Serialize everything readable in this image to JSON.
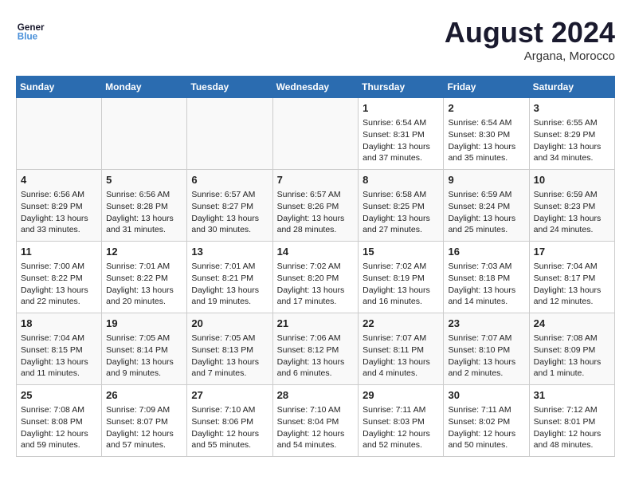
{
  "logo": {
    "line1": "General",
    "line2": "Blue"
  },
  "title": "August 2024",
  "location": "Argana, Morocco",
  "days_of_week": [
    "Sunday",
    "Monday",
    "Tuesday",
    "Wednesday",
    "Thursday",
    "Friday",
    "Saturday"
  ],
  "weeks": [
    [
      {
        "day": "",
        "content": ""
      },
      {
        "day": "",
        "content": ""
      },
      {
        "day": "",
        "content": ""
      },
      {
        "day": "",
        "content": ""
      },
      {
        "day": "1",
        "content": "Sunrise: 6:54 AM\nSunset: 8:31 PM\nDaylight: 13 hours and 37 minutes."
      },
      {
        "day": "2",
        "content": "Sunrise: 6:54 AM\nSunset: 8:30 PM\nDaylight: 13 hours and 35 minutes."
      },
      {
        "day": "3",
        "content": "Sunrise: 6:55 AM\nSunset: 8:29 PM\nDaylight: 13 hours and 34 minutes."
      }
    ],
    [
      {
        "day": "4",
        "content": "Sunrise: 6:56 AM\nSunset: 8:29 PM\nDaylight: 13 hours and 33 minutes."
      },
      {
        "day": "5",
        "content": "Sunrise: 6:56 AM\nSunset: 8:28 PM\nDaylight: 13 hours and 31 minutes."
      },
      {
        "day": "6",
        "content": "Sunrise: 6:57 AM\nSunset: 8:27 PM\nDaylight: 13 hours and 30 minutes."
      },
      {
        "day": "7",
        "content": "Sunrise: 6:57 AM\nSunset: 8:26 PM\nDaylight: 13 hours and 28 minutes."
      },
      {
        "day": "8",
        "content": "Sunrise: 6:58 AM\nSunset: 8:25 PM\nDaylight: 13 hours and 27 minutes."
      },
      {
        "day": "9",
        "content": "Sunrise: 6:59 AM\nSunset: 8:24 PM\nDaylight: 13 hours and 25 minutes."
      },
      {
        "day": "10",
        "content": "Sunrise: 6:59 AM\nSunset: 8:23 PM\nDaylight: 13 hours and 24 minutes."
      }
    ],
    [
      {
        "day": "11",
        "content": "Sunrise: 7:00 AM\nSunset: 8:22 PM\nDaylight: 13 hours and 22 minutes."
      },
      {
        "day": "12",
        "content": "Sunrise: 7:01 AM\nSunset: 8:22 PM\nDaylight: 13 hours and 20 minutes."
      },
      {
        "day": "13",
        "content": "Sunrise: 7:01 AM\nSunset: 8:21 PM\nDaylight: 13 hours and 19 minutes."
      },
      {
        "day": "14",
        "content": "Sunrise: 7:02 AM\nSunset: 8:20 PM\nDaylight: 13 hours and 17 minutes."
      },
      {
        "day": "15",
        "content": "Sunrise: 7:02 AM\nSunset: 8:19 PM\nDaylight: 13 hours and 16 minutes."
      },
      {
        "day": "16",
        "content": "Sunrise: 7:03 AM\nSunset: 8:18 PM\nDaylight: 13 hours and 14 minutes."
      },
      {
        "day": "17",
        "content": "Sunrise: 7:04 AM\nSunset: 8:17 PM\nDaylight: 13 hours and 12 minutes."
      }
    ],
    [
      {
        "day": "18",
        "content": "Sunrise: 7:04 AM\nSunset: 8:15 PM\nDaylight: 13 hours and 11 minutes."
      },
      {
        "day": "19",
        "content": "Sunrise: 7:05 AM\nSunset: 8:14 PM\nDaylight: 13 hours and 9 minutes."
      },
      {
        "day": "20",
        "content": "Sunrise: 7:05 AM\nSunset: 8:13 PM\nDaylight: 13 hours and 7 minutes."
      },
      {
        "day": "21",
        "content": "Sunrise: 7:06 AM\nSunset: 8:12 PM\nDaylight: 13 hours and 6 minutes."
      },
      {
        "day": "22",
        "content": "Sunrise: 7:07 AM\nSunset: 8:11 PM\nDaylight: 13 hours and 4 minutes."
      },
      {
        "day": "23",
        "content": "Sunrise: 7:07 AM\nSunset: 8:10 PM\nDaylight: 13 hours and 2 minutes."
      },
      {
        "day": "24",
        "content": "Sunrise: 7:08 AM\nSunset: 8:09 PM\nDaylight: 13 hours and 1 minute."
      }
    ],
    [
      {
        "day": "25",
        "content": "Sunrise: 7:08 AM\nSunset: 8:08 PM\nDaylight: 12 hours and 59 minutes."
      },
      {
        "day": "26",
        "content": "Sunrise: 7:09 AM\nSunset: 8:07 PM\nDaylight: 12 hours and 57 minutes."
      },
      {
        "day": "27",
        "content": "Sunrise: 7:10 AM\nSunset: 8:06 PM\nDaylight: 12 hours and 55 minutes."
      },
      {
        "day": "28",
        "content": "Sunrise: 7:10 AM\nSunset: 8:04 PM\nDaylight: 12 hours and 54 minutes."
      },
      {
        "day": "29",
        "content": "Sunrise: 7:11 AM\nSunset: 8:03 PM\nDaylight: 12 hours and 52 minutes."
      },
      {
        "day": "30",
        "content": "Sunrise: 7:11 AM\nSunset: 8:02 PM\nDaylight: 12 hours and 50 minutes."
      },
      {
        "day": "31",
        "content": "Sunrise: 7:12 AM\nSunset: 8:01 PM\nDaylight: 12 hours and 48 minutes."
      }
    ]
  ]
}
